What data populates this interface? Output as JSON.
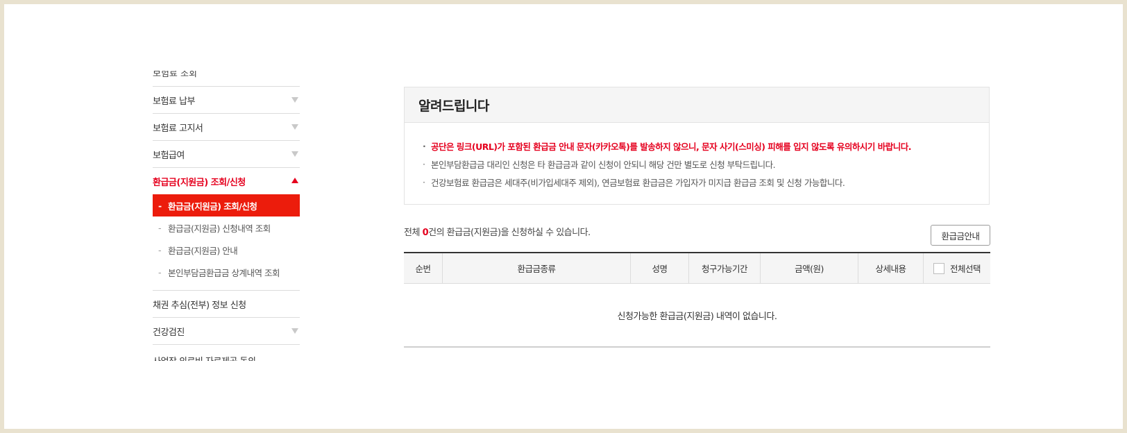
{
  "sidebar": {
    "clipped_top_label": "보험료 조회",
    "items": [
      {
        "label": "보험료 납부"
      },
      {
        "label": "보험료 고지서"
      },
      {
        "label": "보험급여"
      },
      {
        "label": "환급금(지원금) 조회/신청"
      }
    ],
    "submenu": [
      {
        "label": "환급금(지원금) 조회/신청"
      },
      {
        "label": "환급금(지원금) 신청내역 조회"
      },
      {
        "label": "환급금(지원금) 안내"
      },
      {
        "label": "본인부담금환급금 상계내역 조회"
      }
    ],
    "after_items": [
      {
        "label": "채권 추심(전부) 정보 신청"
      },
      {
        "label": "건강검진"
      },
      {
        "label": "사업장 의료비 자료제공 동의"
      }
    ],
    "submenu_dash": "-"
  },
  "notice": {
    "title": "알려드립니다",
    "bullet": "·",
    "lines": [
      "공단은 링크(URL)가 포함된 환급금 안내 문자(카카오톡)를 발송하지 않으니, 문자 사기(스미싱) 피해를 입지 않도록 유의하시기 바랍니다.",
      "본인부담환급금 대리인 신청은 타 환급금과 같이 신청이 안되니 해당 건만 별도로 신청 부탁드립니다.",
      "건강보험료 환급금은 세대주(비가입세대주 제외), 연금보험료 환급금은 가입자가 미지급 환급금 조회 및 신청 가능합니다."
    ]
  },
  "summary": {
    "prefix": "전체 ",
    "count": "0",
    "suffix": "건의 환급금(지원금)을 신청하실 수 있습니다."
  },
  "guide_button": "환급금안내",
  "table": {
    "headers": [
      "순번",
      "환급금종류",
      "성명",
      "청구가능기간",
      "금액(원)",
      "상세내용",
      "전체선택"
    ],
    "empty_message": "신청가능한 환급금(지원금) 내역이 없습니다."
  },
  "colors": {
    "accent": "#e5001e",
    "active_submenu_bg": "#ec1c0c",
    "page_border": "#e9e2cf"
  }
}
